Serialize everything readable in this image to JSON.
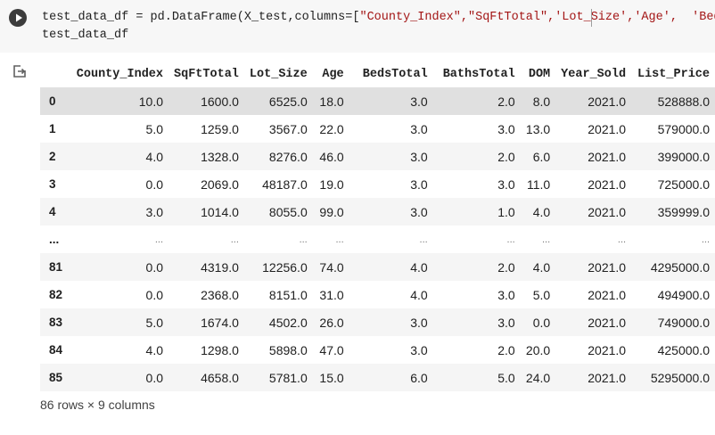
{
  "code": {
    "line1_prefix": "test_data_df = pd.DataFrame(X_test,columns=[",
    "line1_strings": "\"County_Index\",\"SqFtTotal\",'Lot_Size','Age',  'BedsTotal'",
    "line2": "test_data_df"
  },
  "icons": {
    "run": "play-icon",
    "output": "output-redirect-icon"
  },
  "table": {
    "columns": [
      "County_Index",
      "SqFtTotal",
      "Lot_Size",
      "Age",
      "BedsTotal",
      "BathsTotal",
      "DOM",
      "Year_Sold",
      "List_Price"
    ],
    "rows": [
      {
        "index": "0",
        "cells": [
          "10.0",
          "1600.0",
          "6525.0",
          "18.0",
          "3.0",
          "2.0",
          "8.0",
          "2021.0",
          "528888.0"
        ]
      },
      {
        "index": "1",
        "cells": [
          "5.0",
          "1259.0",
          "3567.0",
          "22.0",
          "3.0",
          "3.0",
          "13.0",
          "2021.0",
          "579000.0"
        ]
      },
      {
        "index": "2",
        "cells": [
          "4.0",
          "1328.0",
          "8276.0",
          "46.0",
          "3.0",
          "2.0",
          "6.0",
          "2021.0",
          "399000.0"
        ]
      },
      {
        "index": "3",
        "cells": [
          "0.0",
          "2069.0",
          "48187.0",
          "19.0",
          "3.0",
          "3.0",
          "11.0",
          "2021.0",
          "725000.0"
        ]
      },
      {
        "index": "4",
        "cells": [
          "3.0",
          "1014.0",
          "8055.0",
          "99.0",
          "3.0",
          "1.0",
          "4.0",
          "2021.0",
          "359999.0"
        ]
      },
      {
        "index": "...",
        "cells": [
          "...",
          "...",
          "...",
          "...",
          "...",
          "...",
          "...",
          "...",
          "..."
        ]
      },
      {
        "index": "81",
        "cells": [
          "0.0",
          "4319.0",
          "12256.0",
          "74.0",
          "4.0",
          "2.0",
          "4.0",
          "2021.0",
          "4295000.0"
        ]
      },
      {
        "index": "82",
        "cells": [
          "0.0",
          "2368.0",
          "8151.0",
          "31.0",
          "4.0",
          "3.0",
          "5.0",
          "2021.0",
          "494900.0"
        ]
      },
      {
        "index": "83",
        "cells": [
          "5.0",
          "1674.0",
          "4502.0",
          "26.0",
          "3.0",
          "3.0",
          "0.0",
          "2021.0",
          "749000.0"
        ]
      },
      {
        "index": "84",
        "cells": [
          "4.0",
          "1298.0",
          "5898.0",
          "47.0",
          "3.0",
          "2.0",
          "20.0",
          "2021.0",
          "425000.0"
        ]
      },
      {
        "index": "85",
        "cells": [
          "0.0",
          "4658.0",
          "5781.0",
          "15.0",
          "6.0",
          "5.0",
          "24.0",
          "2021.0",
          "5295000.0"
        ]
      }
    ],
    "highlighted_row": 0
  },
  "summary": "86 rows × 9 columns"
}
